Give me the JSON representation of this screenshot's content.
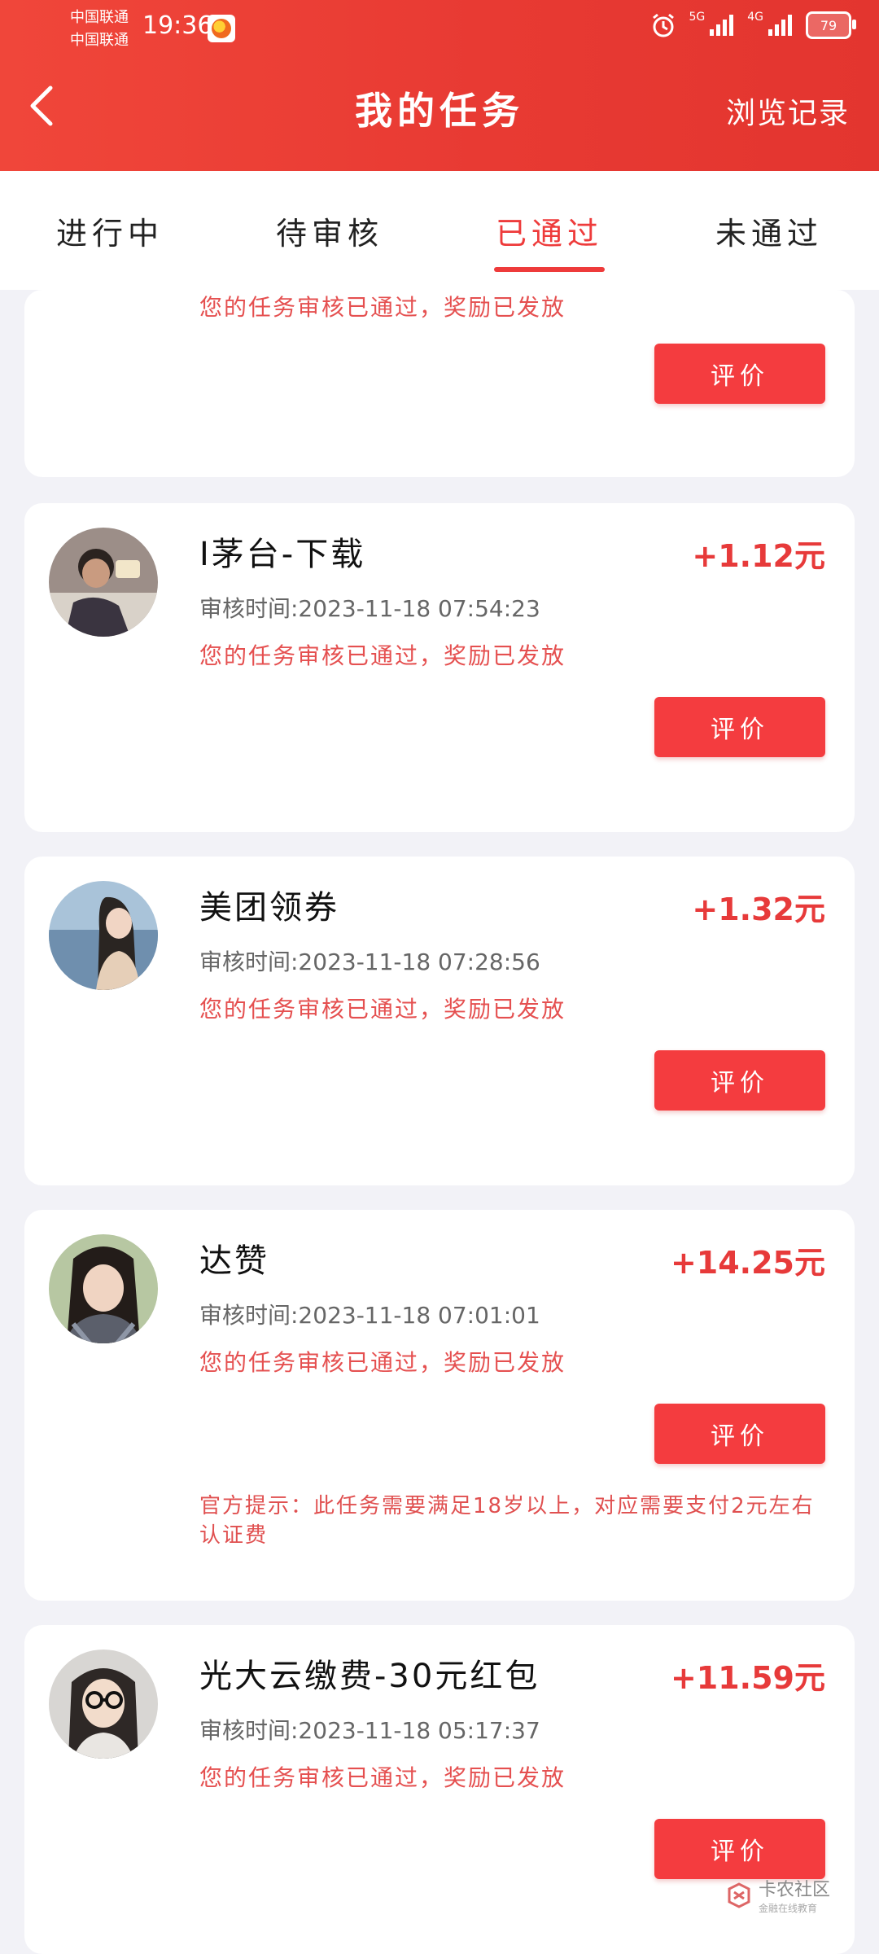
{
  "status_bar": {
    "carrier_1": "中国联通",
    "carrier_2": "中国联通",
    "time": "19:36",
    "network_1": "5G",
    "network_2": "4G",
    "battery": "79"
  },
  "header": {
    "back_icon": "chevron-left-icon",
    "title": "我的任务",
    "history_link": "浏览记录"
  },
  "tabs": [
    {
      "label": "进行中",
      "active": false
    },
    {
      "label": "待审核",
      "active": false
    },
    {
      "label": "已通过",
      "active": true
    },
    {
      "label": "未通过",
      "active": false
    }
  ],
  "partial_card": {
    "status": "您的任务审核已通过，奖励已发放",
    "button": "评价"
  },
  "tasks": [
    {
      "title": "I茅台-下载",
      "reward": "+1.12元",
      "review_time": "审核时间:2023-11-18 07:54:23",
      "status": "您的任务审核已通过，奖励已发放",
      "button": "评价",
      "avatar": "boy-on-phone"
    },
    {
      "title": "美团领券",
      "reward": "+1.32元",
      "review_time": "审核时间:2023-11-18 07:28:56",
      "status": "您的任务审核已通过，奖励已发放",
      "button": "评价",
      "avatar": "girl-by-sea"
    },
    {
      "title": "达赞",
      "reward": "+14.25元",
      "review_time": "审核时间:2023-11-18 07:01:01",
      "status": "您的任务审核已通过，奖励已发放",
      "button": "评价",
      "tip": "官方提示：此任务需要满足18岁以上，对应需要支付2元左右认证费",
      "avatar": "girl-smiling"
    },
    {
      "title": "光大云缴费-30元红包",
      "reward": "+11.59元",
      "review_time": "审核时间:2023-11-18 05:17:37",
      "status": "您的任务审核已通过，奖励已发放",
      "button": "评价",
      "avatar": "girl-glasses"
    }
  ],
  "watermark": {
    "main": "卡农社区",
    "sub": "金融在线教育"
  }
}
